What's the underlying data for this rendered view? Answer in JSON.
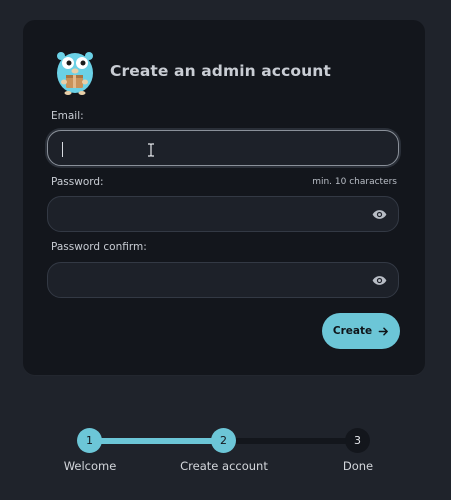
{
  "form": {
    "title": "Create an admin account",
    "email": {
      "label": "Email:",
      "value": "",
      "placeholder": ""
    },
    "password": {
      "label": "Password:",
      "hint": "min. 10 characters",
      "value": ""
    },
    "password_confirm": {
      "label": "Password confirm:",
      "value": ""
    },
    "create_label": "Create",
    "logo_icon": "gopher-mascot-icon",
    "toggle_icon": "eye-icon",
    "arrow_icon": "arrow-right-icon"
  },
  "stepper": {
    "steps": [
      {
        "number": "1",
        "label": "Welcome",
        "state": "done"
      },
      {
        "number": "2",
        "label": "Create account",
        "state": "current"
      },
      {
        "number": "3",
        "label": "Done",
        "state": "todo"
      }
    ]
  },
  "colors": {
    "accent": "#6cc6d7",
    "background": "#1f232b",
    "card": "#13161c",
    "input": "#1d2129"
  }
}
